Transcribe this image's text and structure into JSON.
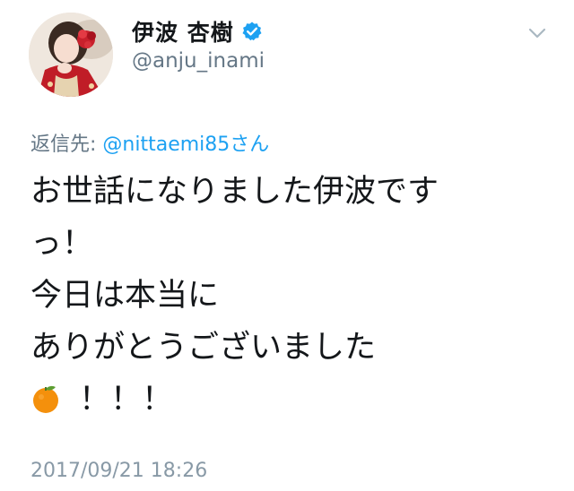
{
  "user": {
    "display_name": "伊波 杏樹",
    "handle": "@anju_inami",
    "verified": true,
    "avatar_icon": "avatar-photo"
  },
  "reply": {
    "prefix": "返信先: ",
    "mention": "@nittaemi85さん"
  },
  "tweet": {
    "lines": [
      "お世話になりました伊波です",
      "っ！",
      "今日は本当に",
      "ありがとうございました"
    ],
    "last_line_emoji": "tangerine-emoji",
    "last_line_text": "！！！"
  },
  "timestamp": "2017/09/21 18:26",
  "colors": {
    "link": "#1da1f2",
    "secondary": "#657786",
    "verified": "#1da1f2",
    "text": "#14171a"
  },
  "icons": {
    "more": "chevron-down-icon",
    "verified": "verified-badge-icon"
  }
}
